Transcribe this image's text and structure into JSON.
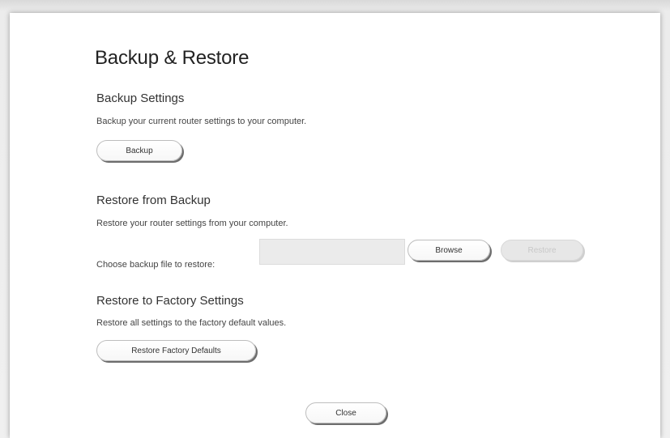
{
  "dialog": {
    "title": "Backup & Restore",
    "close_label": "Close"
  },
  "backup": {
    "heading": "Backup Settings",
    "description": "Backup your current router settings to your computer.",
    "button_label": "Backup"
  },
  "restore": {
    "heading": "Restore from Backup",
    "description": "Restore your router settings from your computer.",
    "file_label": "Choose backup file to restore:",
    "file_value": "",
    "browse_label": "Browse",
    "restore_label": "Restore",
    "restore_enabled": false
  },
  "factory": {
    "heading": "Restore to Factory Settings",
    "description": "Restore all settings to the factory default values.",
    "button_label": "Restore Factory Defaults"
  }
}
